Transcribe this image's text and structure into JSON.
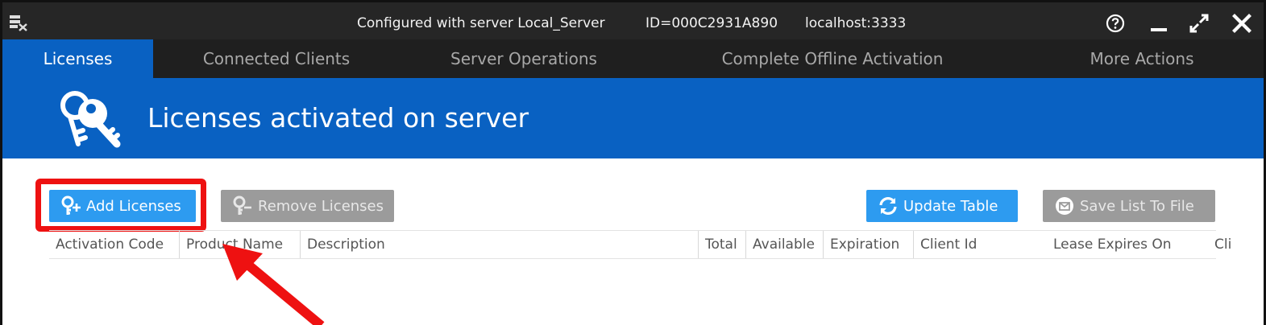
{
  "titlebar": {
    "server_text": "Configured with server Local_Server",
    "id_text": "ID=000C2931A890",
    "host_text": "localhost:3333",
    "icons": [
      "app-icon",
      "help-icon",
      "minimize-icon",
      "maximize-icon",
      "close-icon"
    ]
  },
  "tabs": [
    {
      "label": "Licenses",
      "active": true
    },
    {
      "label": "Connected Clients",
      "active": false
    },
    {
      "label": "Server Operations",
      "active": false
    },
    {
      "label": "Complete Offline Activation",
      "active": false
    },
    {
      "label": "More Actions",
      "active": false
    }
  ],
  "banner": {
    "title": "Licenses activated on server",
    "icon": "keys-icon"
  },
  "toolbar": {
    "add_label": "Add Licenses",
    "remove_label": "Remove Licenses",
    "update_label": "Update Table",
    "save_label": "Save List To File"
  },
  "table": {
    "columns": [
      "Activation Code",
      "Product Name",
      "Description",
      "Total",
      "Available",
      "Expiration",
      "Client Id",
      "Lease Expires On",
      "Cli"
    ]
  },
  "colors": {
    "titlebar_bg": "#262626",
    "tab_bg": "#1f1f1f",
    "accent_blue": "#0961c2",
    "button_blue": "#2d9bf0",
    "button_disabled": "#9b9b9b",
    "annotation_red": "#ee1111"
  }
}
